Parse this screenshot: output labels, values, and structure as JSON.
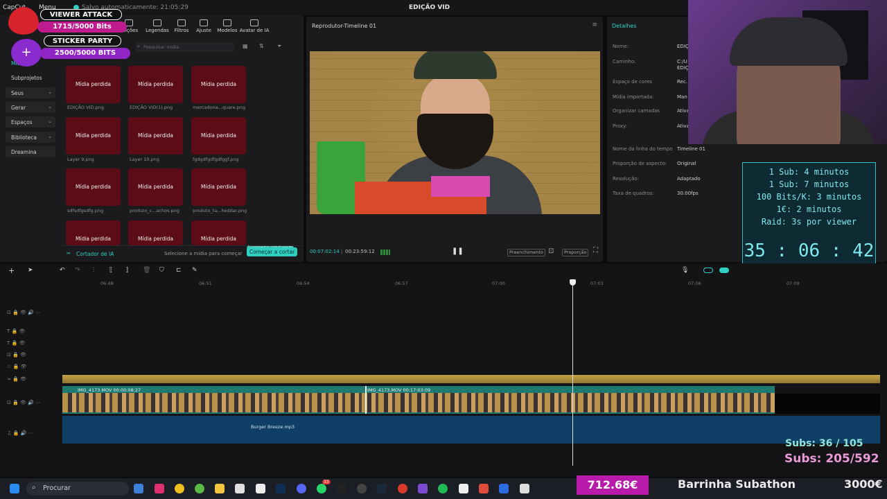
{
  "titlebar": {
    "app_logo": "CapCut",
    "menu_label": "Menu",
    "autosave": "Salvo automaticamente: 21:05:29",
    "project_title": "EDIÇÃO VID"
  },
  "toolbar": {
    "tabs": [
      {
        "label": "Transições",
        "icon": "transition-icon"
      },
      {
        "label": "Legendas",
        "icon": "captions-icon"
      },
      {
        "label": "Filtros",
        "icon": "filter-icon"
      },
      {
        "label": "Ajuste",
        "icon": "adjust-icon"
      },
      {
        "label": "Modelos",
        "icon": "template-icon"
      },
      {
        "label": "Avatar de IA",
        "icon": "avatar-icon"
      }
    ],
    "short_transitions": "nsições"
  },
  "sidebar": {
    "active": "Mídia",
    "items": [
      {
        "label": "Subprojetos",
        "chevron": false
      },
      {
        "label": "Seus",
        "chevron": true
      },
      {
        "label": "Gerar",
        "chevron": true
      },
      {
        "label": "Espaços",
        "chevron": true
      },
      {
        "label": "Biblioteca",
        "chevron": true
      },
      {
        "label": "Dreamina",
        "chevron": false
      }
    ]
  },
  "media": {
    "search_placeholder": "Pesquisar mídia",
    "missing_label": "Mídia perdida",
    "files": [
      "EDIÇÃO VID.png",
      "EDIÇÃO VID(1).png",
      "mercadona...quare.png",
      "Layer 9.png",
      "Layer 10.png",
      "fgdgdfgdfgdfggf.png",
      "sdfsdfgsdfg.png",
      "produto_c...achos.png",
      "produto_ta...heddar.png",
      "",
      "",
      ""
    ],
    "ai_cutter_label": "Cortador de IA",
    "select_hint": "Selecione a mídia para começar",
    "free_badge": "Experimentar gratuitamente",
    "start_button": "Começar a cortar"
  },
  "player": {
    "title": "Reprodutor-Timeline 01",
    "current_time": "00:07:02:14",
    "total_time": "00:23:59:12",
    "fill_button": "Preenchimento",
    "ratio_button": "Proporção"
  },
  "details": {
    "title": "Detalhes",
    "rows": [
      {
        "label": "Nome:",
        "value": "EDIÇ"
      },
      {
        "label": "Caminho:",
        "value": "C:/U"
      },
      {
        "label": "",
        "value": "EDIÇ"
      },
      {
        "label": "Espaço de cores",
        "value": "Rec."
      },
      {
        "label": "Mídia importada:",
        "value": "Man"
      },
      {
        "label": "Organizar camadas",
        "value": "Ativa"
      },
      {
        "label": "Proxy:",
        "value": "Ativa"
      },
      {
        "label": "Nome da linha do tempo",
        "value": "Timeline 01"
      },
      {
        "label": "Proporção de aspecto:",
        "value": "Original"
      },
      {
        "label": "Resolução:",
        "value": "Adaptado"
      },
      {
        "label": "Taxa de quadros:",
        "value": "30.00fps"
      }
    ]
  },
  "overlay": {
    "viewer_attack": "VIEWER ATTACK",
    "bits1": "1715/5000 Bits",
    "sticker_party": "STICKER PARTY",
    "bits2": "2500/5000 BITS"
  },
  "subathon": {
    "lines": [
      "1 Sub: 4 minutos",
      "1 Sub: 7 minutos",
      "100 Bits/K: 3 minutos",
      "1€: 2 minutos",
      "Raid: 3s por viewer"
    ],
    "timer": "35 : 06 : 42"
  },
  "timeline": {
    "ruler": [
      "06:48",
      "06:51",
      "06:54",
      "06:57",
      "07:00",
      "07:03",
      "07:06",
      "07:09"
    ],
    "clip1_label": "IMG_4173.MOV   00:00:08:27",
    "clip2_label": "IMG_4173.MOV   00:17:03:09",
    "audio_label": "Burger Breeze.mp3"
  },
  "subs": {
    "line1": "Subs: 36 / 105",
    "line2": "Subs: 205/592"
  },
  "taskbar": {
    "search": "Procurar",
    "whatsapp_badge": "33",
    "money": "712.68€",
    "bar_title": "Barrinha Subathon",
    "goal": "3000€"
  }
}
